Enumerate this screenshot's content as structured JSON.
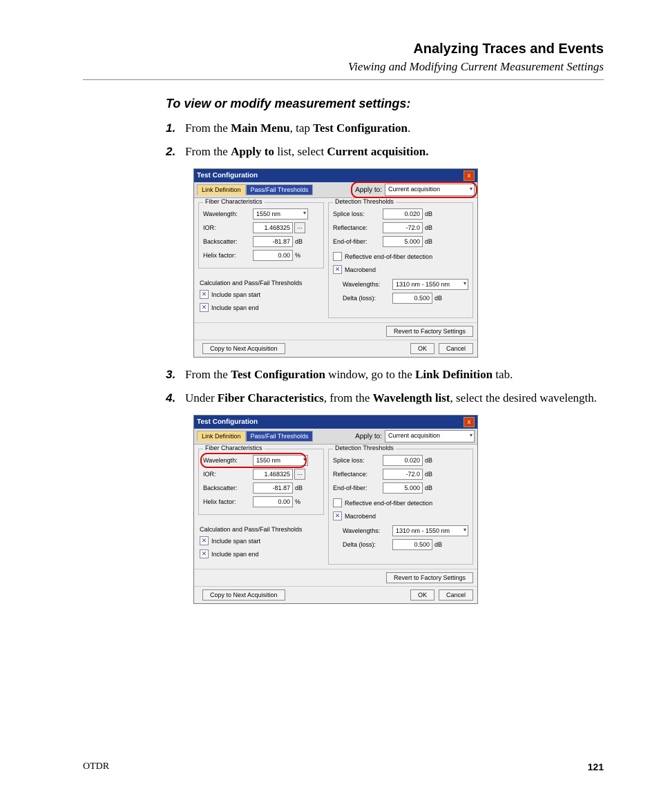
{
  "header": {
    "title": "Analyzing Traces and Events",
    "subtitle": "Viewing and Modifying Current Measurement Settings"
  },
  "instr_title": "To view or modify measurement settings:",
  "steps": {
    "s1": {
      "num": "1.",
      "pre": "From the ",
      "b1": "Main Menu",
      "mid": ", tap ",
      "b2": "Test Configuration",
      "post": "."
    },
    "s2": {
      "num": "2.",
      "pre": "From the ",
      "b1": "Apply to",
      "mid": " list, select ",
      "b2": "Current acquisition.",
      "post": ""
    },
    "s3": {
      "num": "3.",
      "pre": "From the ",
      "b1": "Test Configuration",
      "mid": " window, go to the ",
      "b2": "Link Definition",
      "post": " tab."
    },
    "s4": {
      "num": "4.",
      "pre": "Under ",
      "b1": "Fiber Characteristics",
      "mid": ", from the ",
      "b2": "Wavelength list",
      "post": ", select the desired wavelength."
    }
  },
  "dlg": {
    "title": "Test Configuration",
    "close": "x",
    "tab1": "Link Definition",
    "tab2": "Pass/Fail Thresholds",
    "apply_lbl": "Apply to:",
    "apply_val": "Current acquisition",
    "fiber": {
      "title": "Fiber Characteristics",
      "wavelength_lbl": "Wavelength:",
      "wavelength_val": "1550 nm",
      "ior_lbl": "IOR:",
      "ior_val": "1.468325",
      "back_lbl": "Backscatter:",
      "back_val": "-81.87",
      "back_unit": "dB",
      "helix_lbl": "Helix factor:",
      "helix_val": "0.00",
      "helix_unit": "%",
      "ellipsis": "..."
    },
    "calc": {
      "title": "Calculation and Pass/Fail Thresholds",
      "chk1": "Include span start",
      "chk2": "Include span end",
      "mark": "✕"
    },
    "det": {
      "title": "Detection Thresholds",
      "splice_lbl": "Splice loss:",
      "splice_val": "0.020",
      "refl_lbl": "Reflectance:",
      "refl_val": "-72.0",
      "eof_lbl": "End-of-fiber:",
      "eof_val": "5.000",
      "unit": "dB",
      "reof_lbl": "Reflective end-of-fiber detection",
      "mb_lbl": "Macrobend",
      "wl_lbl": "Wavelengths:",
      "wl_val": "1310 nm - 1550 nm",
      "delta_lbl": "Delta (loss):",
      "delta_val": "0.500"
    },
    "buttons": {
      "revert": "Revert to Factory Settings",
      "copy": "Copy to Next Acquisition",
      "ok": "OK",
      "cancel": "Cancel"
    }
  },
  "footer": {
    "left": "OTDR",
    "right": "121"
  }
}
